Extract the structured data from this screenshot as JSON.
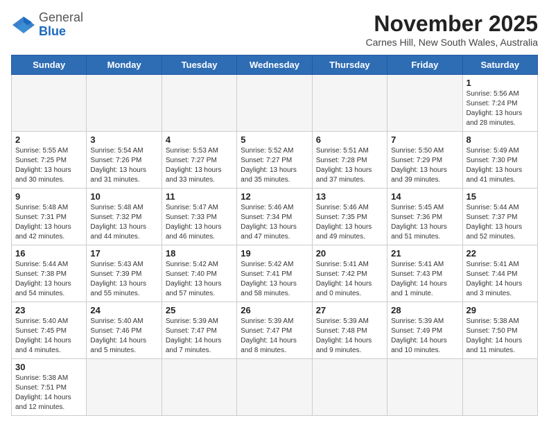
{
  "header": {
    "logo_general": "General",
    "logo_blue": "Blue",
    "month_title": "November 2025",
    "location": "Carnes Hill, New South Wales, Australia"
  },
  "days_of_week": [
    "Sunday",
    "Monday",
    "Tuesday",
    "Wednesday",
    "Thursday",
    "Friday",
    "Saturday"
  ],
  "weeks": [
    [
      {
        "day": "",
        "info": ""
      },
      {
        "day": "",
        "info": ""
      },
      {
        "day": "",
        "info": ""
      },
      {
        "day": "",
        "info": ""
      },
      {
        "day": "",
        "info": ""
      },
      {
        "day": "",
        "info": ""
      },
      {
        "day": "1",
        "info": "Sunrise: 5:56 AM\nSunset: 7:24 PM\nDaylight: 13 hours and 28 minutes."
      }
    ],
    [
      {
        "day": "2",
        "info": "Sunrise: 5:55 AM\nSunset: 7:25 PM\nDaylight: 13 hours and 30 minutes."
      },
      {
        "day": "3",
        "info": "Sunrise: 5:54 AM\nSunset: 7:26 PM\nDaylight: 13 hours and 31 minutes."
      },
      {
        "day": "4",
        "info": "Sunrise: 5:53 AM\nSunset: 7:27 PM\nDaylight: 13 hours and 33 minutes."
      },
      {
        "day": "5",
        "info": "Sunrise: 5:52 AM\nSunset: 7:27 PM\nDaylight: 13 hours and 35 minutes."
      },
      {
        "day": "6",
        "info": "Sunrise: 5:51 AM\nSunset: 7:28 PM\nDaylight: 13 hours and 37 minutes."
      },
      {
        "day": "7",
        "info": "Sunrise: 5:50 AM\nSunset: 7:29 PM\nDaylight: 13 hours and 39 minutes."
      },
      {
        "day": "8",
        "info": "Sunrise: 5:49 AM\nSunset: 7:30 PM\nDaylight: 13 hours and 41 minutes."
      }
    ],
    [
      {
        "day": "9",
        "info": "Sunrise: 5:48 AM\nSunset: 7:31 PM\nDaylight: 13 hours and 42 minutes."
      },
      {
        "day": "10",
        "info": "Sunrise: 5:48 AM\nSunset: 7:32 PM\nDaylight: 13 hours and 44 minutes."
      },
      {
        "day": "11",
        "info": "Sunrise: 5:47 AM\nSunset: 7:33 PM\nDaylight: 13 hours and 46 minutes."
      },
      {
        "day": "12",
        "info": "Sunrise: 5:46 AM\nSunset: 7:34 PM\nDaylight: 13 hours and 47 minutes."
      },
      {
        "day": "13",
        "info": "Sunrise: 5:46 AM\nSunset: 7:35 PM\nDaylight: 13 hours and 49 minutes."
      },
      {
        "day": "14",
        "info": "Sunrise: 5:45 AM\nSunset: 7:36 PM\nDaylight: 13 hours and 51 minutes."
      },
      {
        "day": "15",
        "info": "Sunrise: 5:44 AM\nSunset: 7:37 PM\nDaylight: 13 hours and 52 minutes."
      }
    ],
    [
      {
        "day": "16",
        "info": "Sunrise: 5:44 AM\nSunset: 7:38 PM\nDaylight: 13 hours and 54 minutes."
      },
      {
        "day": "17",
        "info": "Sunrise: 5:43 AM\nSunset: 7:39 PM\nDaylight: 13 hours and 55 minutes."
      },
      {
        "day": "18",
        "info": "Sunrise: 5:42 AM\nSunset: 7:40 PM\nDaylight: 13 hours and 57 minutes."
      },
      {
        "day": "19",
        "info": "Sunrise: 5:42 AM\nSunset: 7:41 PM\nDaylight: 13 hours and 58 minutes."
      },
      {
        "day": "20",
        "info": "Sunrise: 5:41 AM\nSunset: 7:42 PM\nDaylight: 14 hours and 0 minutes."
      },
      {
        "day": "21",
        "info": "Sunrise: 5:41 AM\nSunset: 7:43 PM\nDaylight: 14 hours and 1 minute."
      },
      {
        "day": "22",
        "info": "Sunrise: 5:41 AM\nSunset: 7:44 PM\nDaylight: 14 hours and 3 minutes."
      }
    ],
    [
      {
        "day": "23",
        "info": "Sunrise: 5:40 AM\nSunset: 7:45 PM\nDaylight: 14 hours and 4 minutes."
      },
      {
        "day": "24",
        "info": "Sunrise: 5:40 AM\nSunset: 7:46 PM\nDaylight: 14 hours and 5 minutes."
      },
      {
        "day": "25",
        "info": "Sunrise: 5:39 AM\nSunset: 7:47 PM\nDaylight: 14 hours and 7 minutes."
      },
      {
        "day": "26",
        "info": "Sunrise: 5:39 AM\nSunset: 7:47 PM\nDaylight: 14 hours and 8 minutes."
      },
      {
        "day": "27",
        "info": "Sunrise: 5:39 AM\nSunset: 7:48 PM\nDaylight: 14 hours and 9 minutes."
      },
      {
        "day": "28",
        "info": "Sunrise: 5:39 AM\nSunset: 7:49 PM\nDaylight: 14 hours and 10 minutes."
      },
      {
        "day": "29",
        "info": "Sunrise: 5:38 AM\nSunset: 7:50 PM\nDaylight: 14 hours and 11 minutes."
      }
    ],
    [
      {
        "day": "30",
        "info": "Sunrise: 5:38 AM\nSunset: 7:51 PM\nDaylight: 14 hours and 12 minutes."
      },
      {
        "day": "",
        "info": ""
      },
      {
        "day": "",
        "info": ""
      },
      {
        "day": "",
        "info": ""
      },
      {
        "day": "",
        "info": ""
      },
      {
        "day": "",
        "info": ""
      },
      {
        "day": "",
        "info": ""
      }
    ]
  ]
}
